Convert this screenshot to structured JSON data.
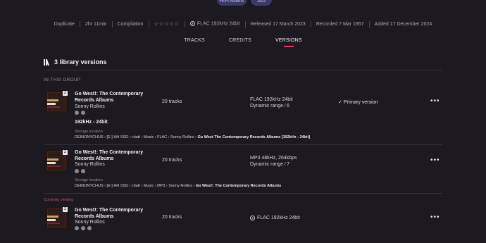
{
  "top_chips": [
    "Hi-Fi Albums",
    "Jazz"
  ],
  "meta": {
    "items": [
      "Duplicate",
      "2hr 11min",
      "Compilation"
    ],
    "stars": "☆☆☆☆☆",
    "format": "FLAC 192kHz 24bit",
    "released": "Released 17 March 2023",
    "recorded": "Recorded 7 Mar 1957",
    "added": "Added 17 December 2024"
  },
  "tabs": [
    "TRACKS",
    "CREDITS",
    "VERSIONS"
  ],
  "active_tab": "VERSIONS",
  "section_title": "3 library versions",
  "group_label": "IN THIS GROUP",
  "versions": [
    {
      "title": "Go West!: The Contemporary Records Albums",
      "artist": "Sonny Rollins",
      "tracks": "20 tracks",
      "format": "FLAC 192kHz 24bit",
      "dynamic_range": "Dynamic range ∕ 6",
      "status": "Primary version",
      "quality": "192kHz - 24bit",
      "storage_label": "Storage location",
      "path": [
        "DEINONYCHUS",
        "[E:] Hifi SSD",
        "chatt",
        "Music",
        "FLAC",
        "Sonny Rollins",
        "Go West   The Contemporary Records Albums [192kHz - 24bit]"
      ],
      "cover_badge": "2"
    },
    {
      "title": "Go West!: The Contemporary Records Albums",
      "artist": "Sonny Rollins",
      "tracks": "20 tracks",
      "format": "MP3 48kHz, 264kbps",
      "dynamic_range": "Dynamic range ∕ 7",
      "storage_label": "Storage location",
      "path": [
        "DEINONYCHUS",
        "[E:] Hifi SSD",
        "chatt",
        "Music",
        "MP3",
        "Sonny Rollins",
        "Go West!: The Contemporary Records Albums"
      ],
      "cover_badge": "2"
    },
    {
      "currently_viewing": "Currently viewing",
      "title": "Go West!: The Contemporary Records Albums",
      "artist": "Sonny Rollins",
      "tracks": "20 tracks",
      "format": "FLAC 192kHz 24bit",
      "cover_badge": "2"
    }
  ],
  "colors": {
    "background": "#1c1a20",
    "accent": "#e0404a",
    "chip": "#3a3a6a"
  }
}
